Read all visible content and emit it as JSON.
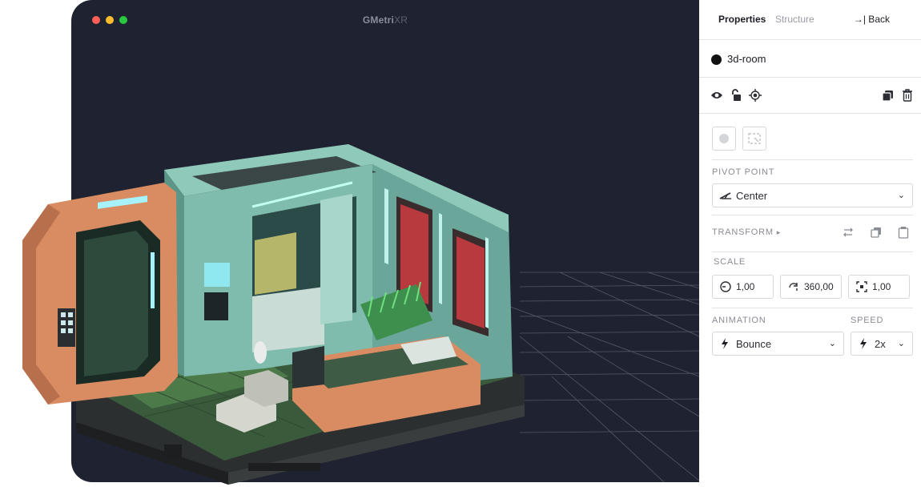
{
  "window": {
    "title_bold": "GMetri",
    "title_thin": "XR",
    "traffic_lights": [
      "#ff5f57",
      "#febc2e",
      "#28c840"
    ]
  },
  "panel": {
    "tabs": [
      {
        "label": "Properties",
        "active": true
      },
      {
        "label": "Structure",
        "active": false
      }
    ],
    "back_label": "→| Back",
    "object_name": "3d-room",
    "pivot": {
      "label": "PIVOT POINT",
      "value": "Center"
    },
    "transform": {
      "label": "TRANSFORM",
      "arrow": "▸"
    },
    "scale": {
      "label": "SCALE",
      "fields": [
        "1,00",
        "360,00",
        "1,00"
      ]
    },
    "animation": {
      "label": "ANIMATION",
      "value": "Bounce"
    },
    "speed": {
      "label": "SPEED",
      "value": "2x"
    }
  },
  "icons": [
    "eye-icon",
    "unlock-icon",
    "target-icon",
    "duplicate-icon",
    "trash-icon",
    "swap-icon",
    "copy-icon",
    "paste-icon",
    "bolt-icon",
    "rotate-icon",
    "expand-icon"
  ]
}
